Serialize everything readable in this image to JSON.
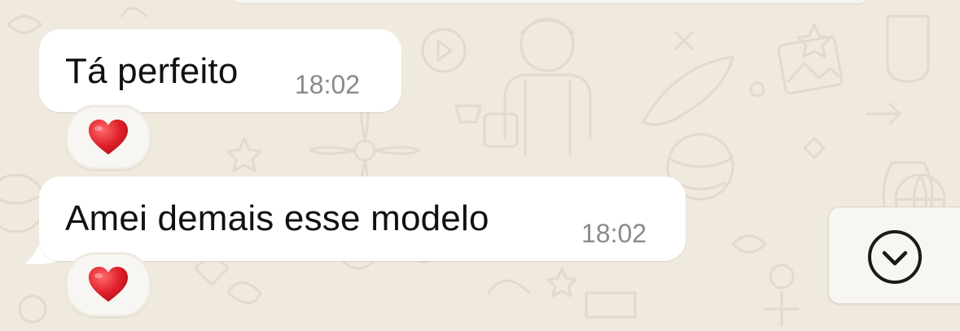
{
  "messages": [
    {
      "text": "Tá perfeito",
      "time": "18:02",
      "reaction": "❤️"
    },
    {
      "text": "Amei demais esse modelo",
      "time": "18:02",
      "reaction": "❤️"
    }
  ],
  "icons": {
    "scroll_down": "chevron-down-circle-icon",
    "reaction": "red-heart-icon"
  },
  "colors": {
    "wallpaper": "#efe9de",
    "bubble": "#ffffff",
    "timestamp": "#8a8a8a",
    "heart": "#e0202b"
  }
}
